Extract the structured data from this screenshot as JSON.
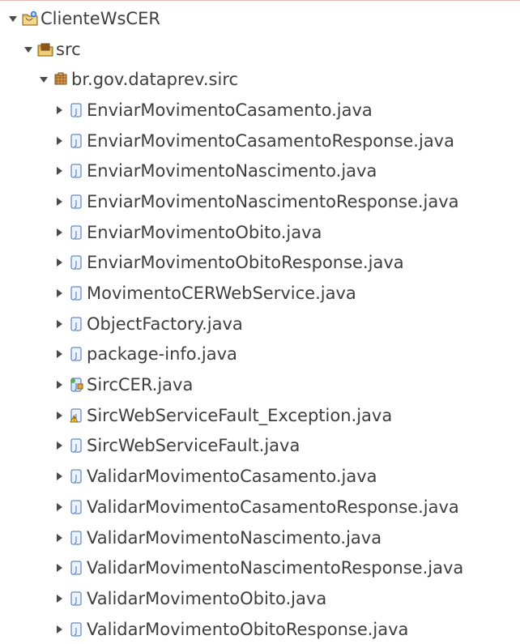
{
  "tree": {
    "project": {
      "label": "ClienteWsCER",
      "icon": "java-project-icon"
    },
    "source_folder": {
      "label": "src",
      "icon": "source-folder-icon"
    },
    "package": {
      "label": "br.gov.dataprev.sirc",
      "icon": "package-icon"
    },
    "files": [
      {
        "label": "EnviarMovimentoCasamento.java",
        "icon": "java-file-icon"
      },
      {
        "label": "EnviarMovimentoCasamentoResponse.java",
        "icon": "java-file-icon"
      },
      {
        "label": "EnviarMovimentoNascimento.java",
        "icon": "java-file-icon"
      },
      {
        "label": "EnviarMovimentoNascimentoResponse.java",
        "icon": "java-file-icon"
      },
      {
        "label": "EnviarMovimentoObito.java",
        "icon": "java-file-icon"
      },
      {
        "label": "EnviarMovimentoObitoResponse.java",
        "icon": "java-file-icon"
      },
      {
        "label": "MovimentoCERWebService.java",
        "icon": "java-file-icon"
      },
      {
        "label": "ObjectFactory.java",
        "icon": "java-file-icon"
      },
      {
        "label": "package-info.java",
        "icon": "java-file-icon"
      },
      {
        "label": "SircCER.java",
        "icon": "java-file-service-icon"
      },
      {
        "label": "SircWebServiceFault_Exception.java",
        "icon": "java-file-warning-icon"
      },
      {
        "label": "SircWebServiceFault.java",
        "icon": "java-file-icon"
      },
      {
        "label": "ValidarMovimentoCasamento.java",
        "icon": "java-file-icon"
      },
      {
        "label": "ValidarMovimentoCasamentoResponse.java",
        "icon": "java-file-icon"
      },
      {
        "label": "ValidarMovimentoNascimento.java",
        "icon": "java-file-icon"
      },
      {
        "label": "ValidarMovimentoNascimentoResponse.java",
        "icon": "java-file-icon"
      },
      {
        "label": "ValidarMovimentoObito.java",
        "icon": "java-file-icon"
      },
      {
        "label": "ValidarMovimentoObitoResponse.java",
        "icon": "java-file-icon"
      }
    ]
  },
  "colors": {
    "text": "#3e3e3e",
    "arrow": "#4a4a4a",
    "java_icon_blue": "#3c6cb4",
    "java_icon_fill": "#eef4ff",
    "top_border": "#e9b7b1"
  }
}
